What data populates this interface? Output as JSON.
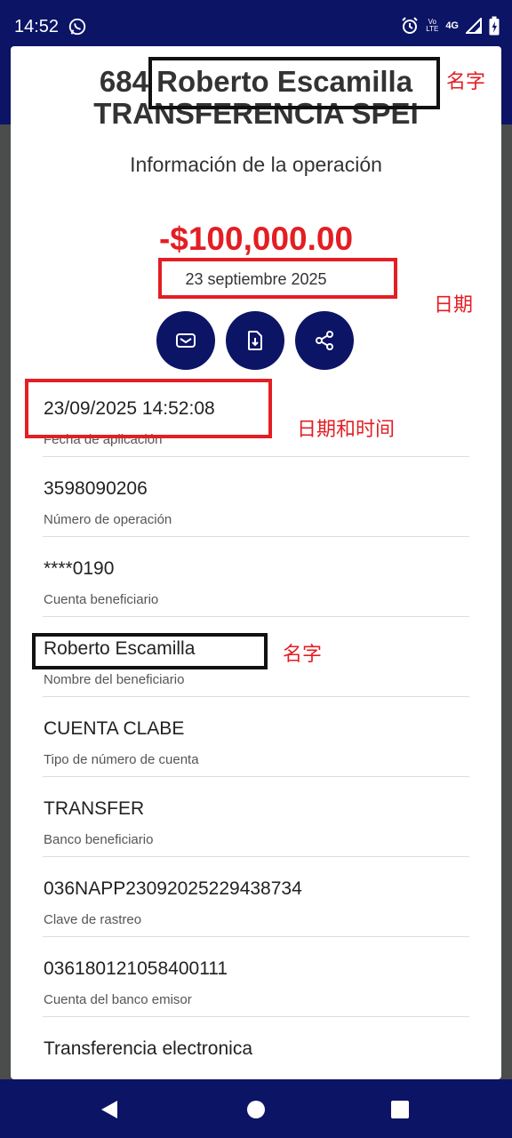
{
  "status_bar": {
    "time": "14:52",
    "volte_top": "Vo",
    "volte_bottom": "LTE",
    "network": "4G"
  },
  "header": {
    "title_line1": "684 Roberto Escamilla",
    "title_line2": "TRANSFERENCIA SPEI",
    "subtitle": "Información de la operación"
  },
  "amount": "-$100,000.00",
  "operation_date": "23 septiembre 2025",
  "actions": [
    {
      "icon": "mail-icon"
    },
    {
      "icon": "download-icon"
    },
    {
      "icon": "share-icon"
    }
  ],
  "details": [
    {
      "value": "23/09/2025 14:52:08",
      "label": "Fecha de aplicación"
    },
    {
      "value": "3598090206",
      "label": "Número de operación"
    },
    {
      "value": "****0190",
      "label": "Cuenta beneficiario"
    },
    {
      "value": "Roberto Escamilla",
      "label": "Nombre del beneficiario"
    },
    {
      "value": "CUENTA CLABE",
      "label": "Tipo de número de cuenta"
    },
    {
      "value": "TRANSFER",
      "label": "Banco beneficiario"
    },
    {
      "value": "036NAPP23092025229438734",
      "label": "Clave de rastreo"
    },
    {
      "value": "036180121058400111",
      "label": "Cuenta del banco emisor"
    },
    {
      "value": "Transferencia electronica",
      "label": ""
    }
  ],
  "annotations": {
    "name_top": "名字",
    "date": "日期",
    "datetime": "日期和时间",
    "name_row": "名字"
  },
  "colors": {
    "navy": "#0c1466",
    "amount_red": "#e31e24",
    "annotation_red": "#e31e24"
  }
}
